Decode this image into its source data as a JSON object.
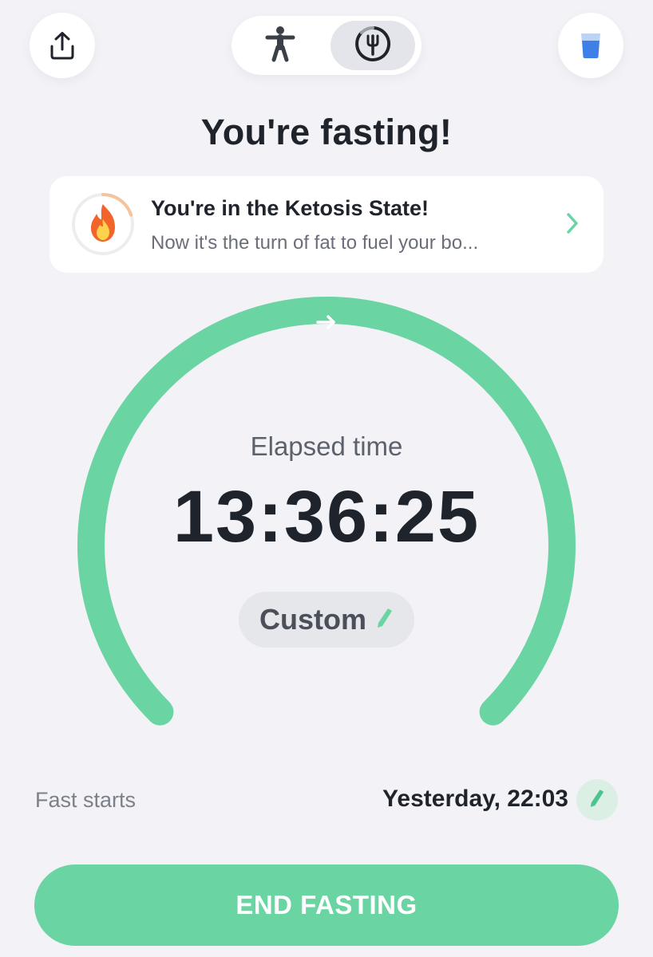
{
  "header": {
    "share_icon": "share-icon",
    "water_icon": "water-glass-icon",
    "mode_toggle": {
      "options": [
        {
          "name": "exercise",
          "icon": "person-icon",
          "selected": false
        },
        {
          "name": "fasting",
          "icon": "fork-timer-icon",
          "selected": true
        }
      ]
    }
  },
  "title": "You're fasting!",
  "state_card": {
    "icon": "flame-icon",
    "title": "You're in the Ketosis State!",
    "subtitle": "Now it's the turn of fat to fuel your bo...",
    "chevron_icon": "chevron-right-icon"
  },
  "timer": {
    "label": "Elapsed time",
    "value": "13:36:25",
    "plan_label": "Custom",
    "plan_edit_icon": "pencil-icon",
    "progress": 1.0,
    "direction_icon": "arrow-right-icon"
  },
  "fast_start": {
    "label": "Fast starts",
    "value": "Yesterday, 22:03",
    "edit_icon": "pencil-icon"
  },
  "end_button_label": "END FASTING",
  "colors": {
    "accent": "#6ad4a3",
    "background": "#f3f3f7",
    "card": "#ffffff",
    "text_primary": "#1f232b",
    "text_secondary": "#6a6e78",
    "flame": "#f2652a",
    "water": "#3f7fe8"
  }
}
